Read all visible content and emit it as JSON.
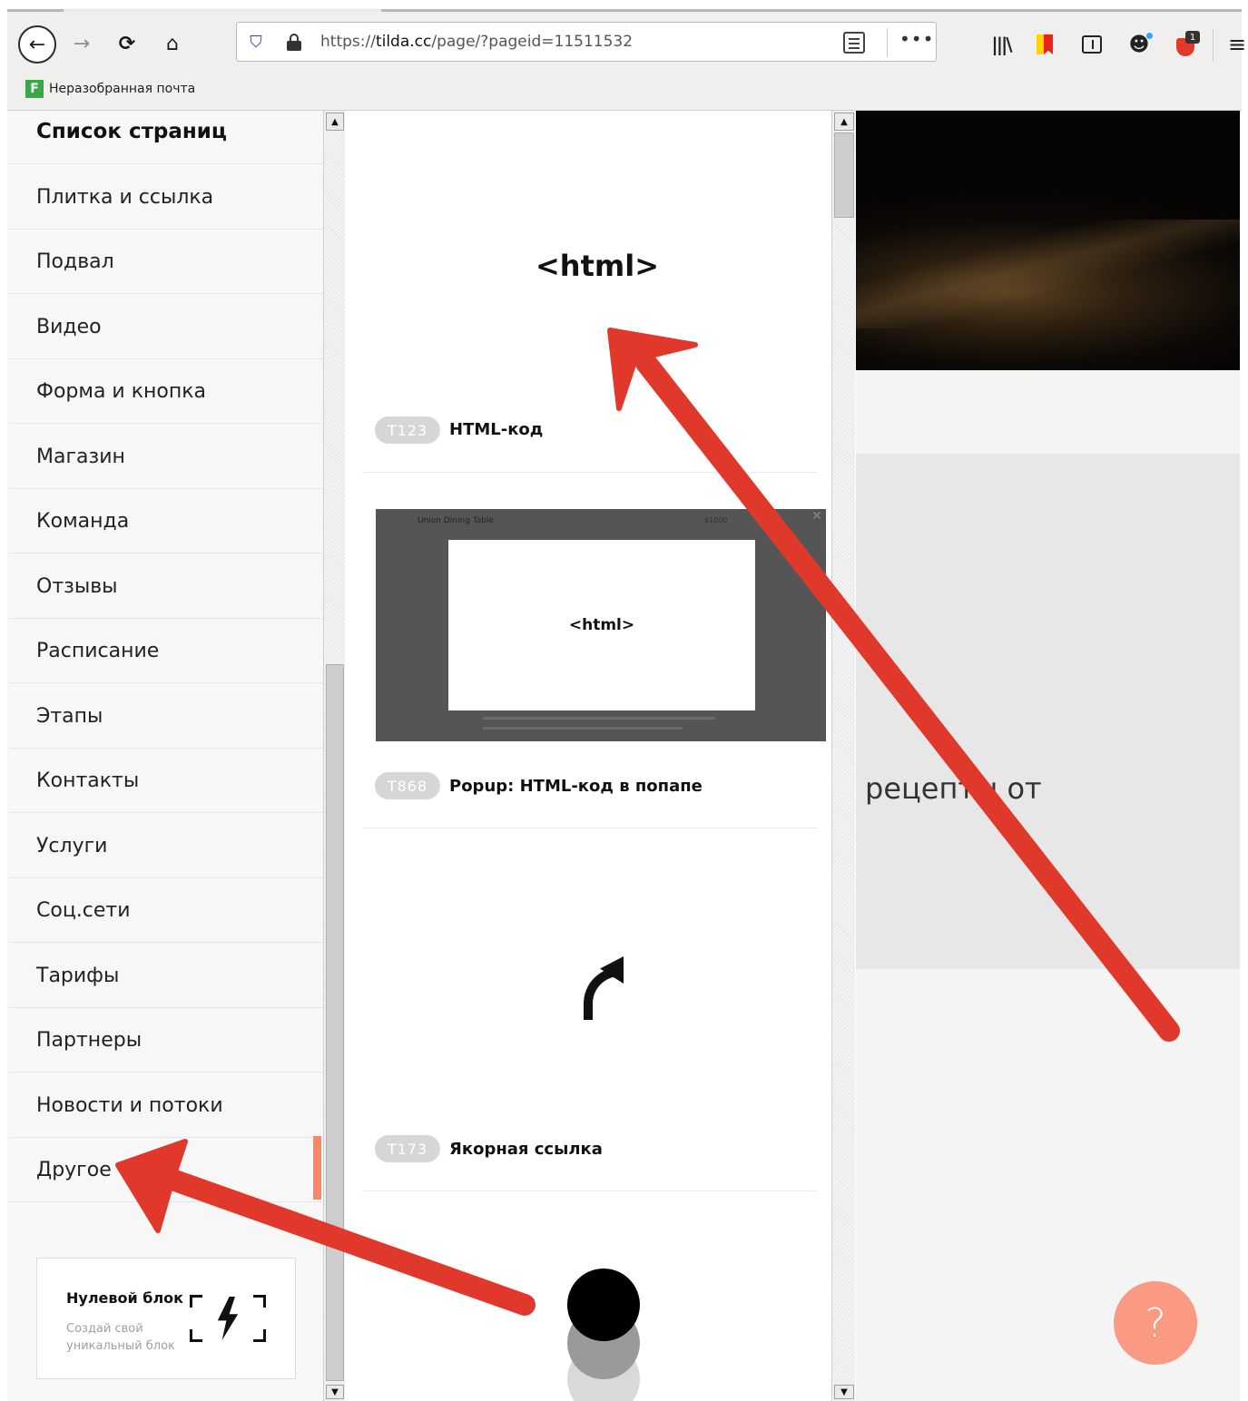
{
  "browser": {
    "url_prefix": "https://",
    "url_domain": "tilda.cc",
    "url_path": "/page/?pageid=11511532",
    "more_label": "•••",
    "addon_badge": "1",
    "bookmark_label": "Неразобранная почта",
    "bookmark_icon_letter": "F"
  },
  "sidebar": {
    "title": "Список страниц",
    "items": [
      {
        "label": "Плитка и ссылка"
      },
      {
        "label": "Подвал"
      },
      {
        "label": "Видео"
      },
      {
        "label": "Форма и кнопка"
      },
      {
        "label": "Магазин"
      },
      {
        "label": "Команда"
      },
      {
        "label": "Отзывы"
      },
      {
        "label": "Расписание"
      },
      {
        "label": "Этапы"
      },
      {
        "label": "Контакты"
      },
      {
        "label": "Услуги"
      },
      {
        "label": "Соц.сети"
      },
      {
        "label": "Тарифы"
      },
      {
        "label": "Партнеры"
      },
      {
        "label": "Новости и потоки"
      },
      {
        "label": "Другое"
      }
    ],
    "active_item": "Другое",
    "zero_block": {
      "title": "Нулевой блок",
      "subtitle": "Создай свой уникальный блок"
    }
  },
  "blocks": {
    "html_preview_label": "<html>",
    "items": [
      {
        "code": "T123",
        "name": "HTML-код"
      },
      {
        "code": "T868",
        "name": "Popup: HTML-код в попапе"
      },
      {
        "code": "T173",
        "name": "Якорная ссылка"
      }
    ],
    "popup_preview": {
      "product": "Union Dining Table",
      "price": "$1000",
      "html_label": "<html>"
    }
  },
  "page_preview": {
    "recipe_text": "рецепты от",
    "help_label": "?"
  },
  "colors": {
    "accent": "#fa8669",
    "help_button": "#fa9a82",
    "annotation_arrow": "#e0392b"
  }
}
